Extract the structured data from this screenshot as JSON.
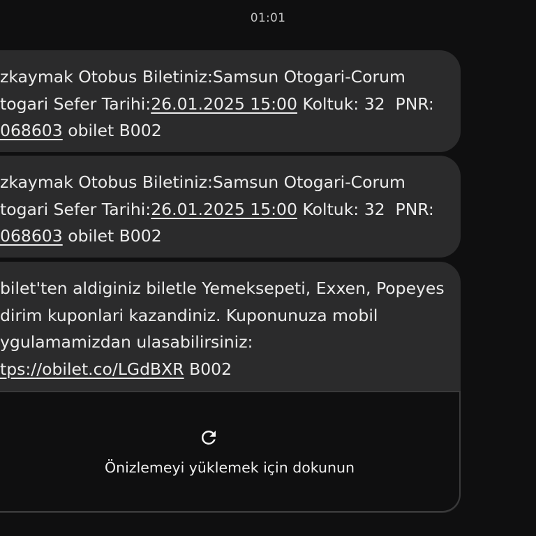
{
  "status": {
    "time": "01:01"
  },
  "messages": [
    {
      "line1": "zkaymak Otobus Biletiniz:Samsun Otogari-Corum",
      "line2_pre": "togari Sefer Tarihi:",
      "line2_link": "26.01.2025 15:00",
      "line2_post": " Koltuk: 32  PNR:",
      "line3_link": "068603",
      "line3_post": " obilet B002"
    },
    {
      "line1": "zkaymak Otobus Biletiniz:Samsun Otogari-Corum",
      "line2_pre": "togari Sefer Tarihi:",
      "line2_link": "26.01.2025 15:00",
      "line2_post": " Koltuk: 32  PNR:",
      "line3_link": "068603",
      "line3_post": " obilet B002"
    },
    {
      "line1": "bilet'ten aldiginiz biletle Yemeksepeti, Exxen, Popeyes",
      "line2": "dirim kuponlari kazandiniz. Kuponunuza mobil",
      "line3": "ygulamamizdan ulasabilirsiniz:",
      "line4_link": "tps://obilet.co/LGdBXR",
      "line4_post": " B002"
    }
  ],
  "preview": {
    "icon": "refresh-icon",
    "hint": "Önizlemeyi yüklemek için dokunun"
  }
}
